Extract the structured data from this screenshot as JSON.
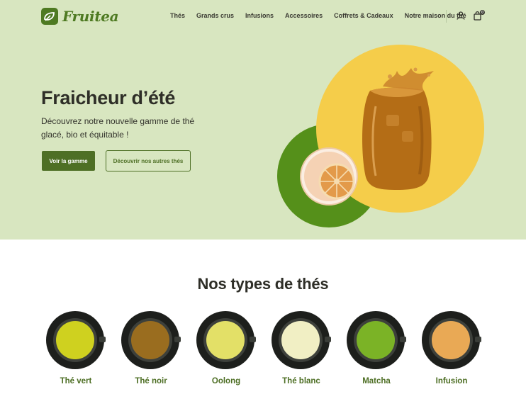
{
  "brand": {
    "name": "Fruitea"
  },
  "nav": {
    "items": [
      "Thés",
      "Grands crus",
      "Infusions",
      "Accessoires",
      "Coffrets & Cadeaux",
      "Notre maison du thé"
    ]
  },
  "header_icons": {
    "account": "user-icon",
    "cart": "shopping-bag-icon",
    "cart_count": "0"
  },
  "hero": {
    "title": "Fraicheur d’été",
    "subtitle": "Découvrez notre nouvelle gamme de thé glacé, bio et équitable !",
    "primary_button": "Voir la gamme",
    "secondary_button": "Découvrir nos autres thés"
  },
  "tea_section": {
    "title": "Nos types de thés",
    "types": [
      {
        "label": "Thé vert",
        "color": "#cfd11f"
      },
      {
        "label": "Thé noir",
        "color": "#9a6d1f"
      },
      {
        "label": "Oolong",
        "color": "#e3e067"
      },
      {
        "label": "Thé blanc",
        "color": "#f1efc4"
      },
      {
        "label": "Matcha",
        "color": "#7bb326"
      },
      {
        "label": "Infusion",
        "color": "#e9a955"
      }
    ]
  },
  "colors": {
    "accent": "#4e6f25",
    "hero_bg": "#d8e6c0",
    "yellow": "#f5cd4a",
    "green_circle": "#55901a"
  }
}
